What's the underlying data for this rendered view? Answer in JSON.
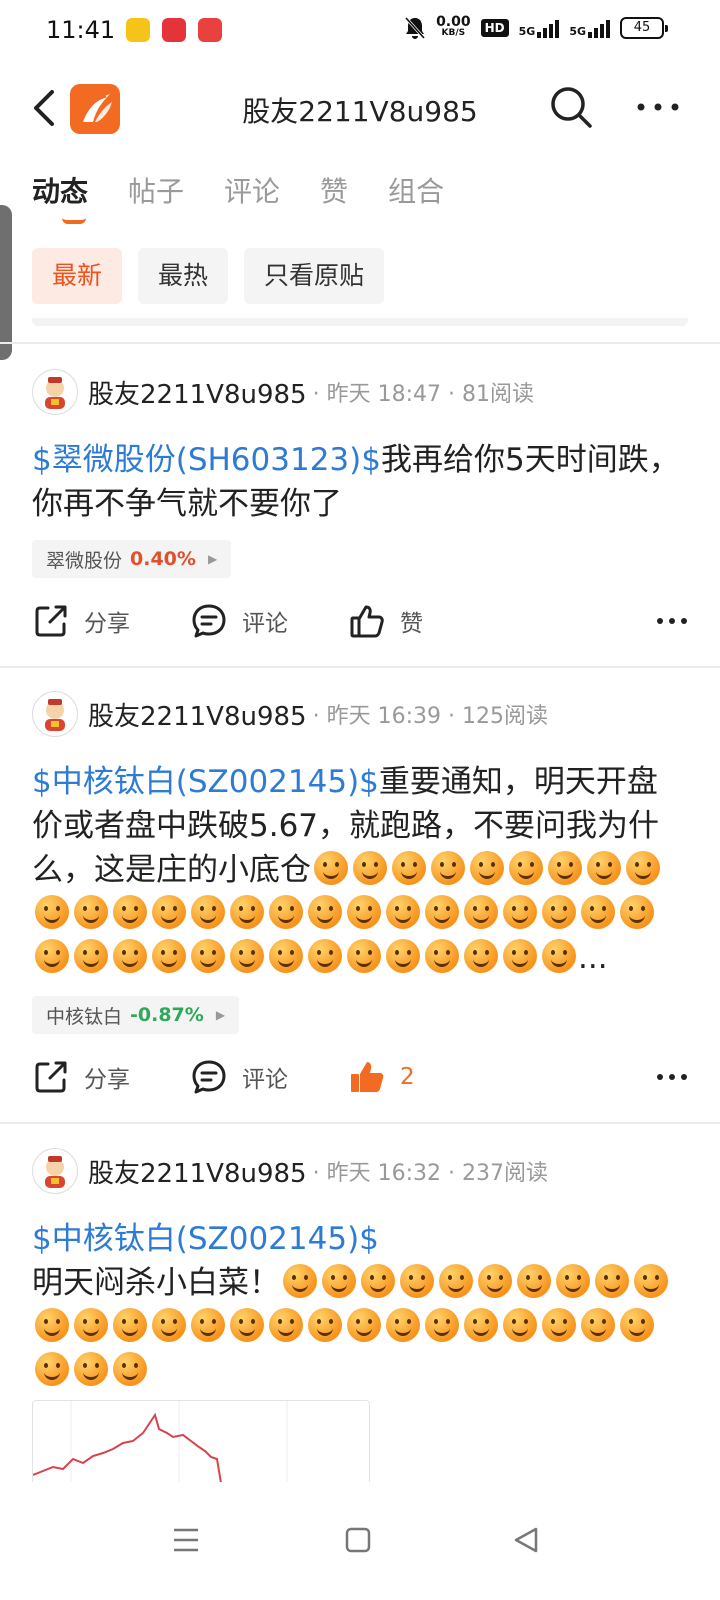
{
  "status_bar": {
    "time": "11:41",
    "net_speed_value": "0.00",
    "net_speed_unit": "KB/S",
    "hd_label": "HD",
    "signal1": "5G",
    "signal2": "5G",
    "battery": "45"
  },
  "header": {
    "title": "股友2211V8u985",
    "brand_color": "#f36a22"
  },
  "tabs": [
    {
      "label": "动态"
    },
    {
      "label": "帖子"
    },
    {
      "label": "评论"
    },
    {
      "label": "赞"
    },
    {
      "label": "组合"
    }
  ],
  "filters": [
    {
      "label": "最新"
    },
    {
      "label": "最热"
    },
    {
      "label": "只看原贴"
    }
  ],
  "posts": [
    {
      "username": "股友2211V8u985",
      "meta": "· 昨天 18:47 · 81阅读",
      "stock_link": "$翠微股份(SH603123)$",
      "text": "我再给你5天时间跌，你再不争气就不要你了",
      "tag_name": "翠微股份",
      "tag_pct": "0.40%",
      "share": "分享",
      "comment": "评论",
      "like": "赞"
    },
    {
      "username": "股友2211V8u985",
      "meta": "· 昨天 16:39 · 125阅读",
      "stock_link": "$中核钛白(SZ002145)$",
      "text": "重要通知，明天开盘价或者盘中跌破5.67，就跑路，不要问我为什么，这是庄的小底仓",
      "emoji_count": 39,
      "ellipsis": "...",
      "tag_name": "中核钛白",
      "tag_pct": "-0.87%",
      "share": "分享",
      "comment": "评论",
      "like": "2"
    },
    {
      "username": "股友2211V8u985",
      "meta": "· 昨天 16:32 · 237阅读",
      "stock_link": "$中核钛白(SZ002145)$",
      "text": "明天闷杀小白菜！",
      "emoji_count": 29
    }
  ],
  "colors": {
    "link": "#2e7bd6",
    "accent": "#f26a21",
    "up": "#e0502a",
    "down": "#2fa85a"
  }
}
